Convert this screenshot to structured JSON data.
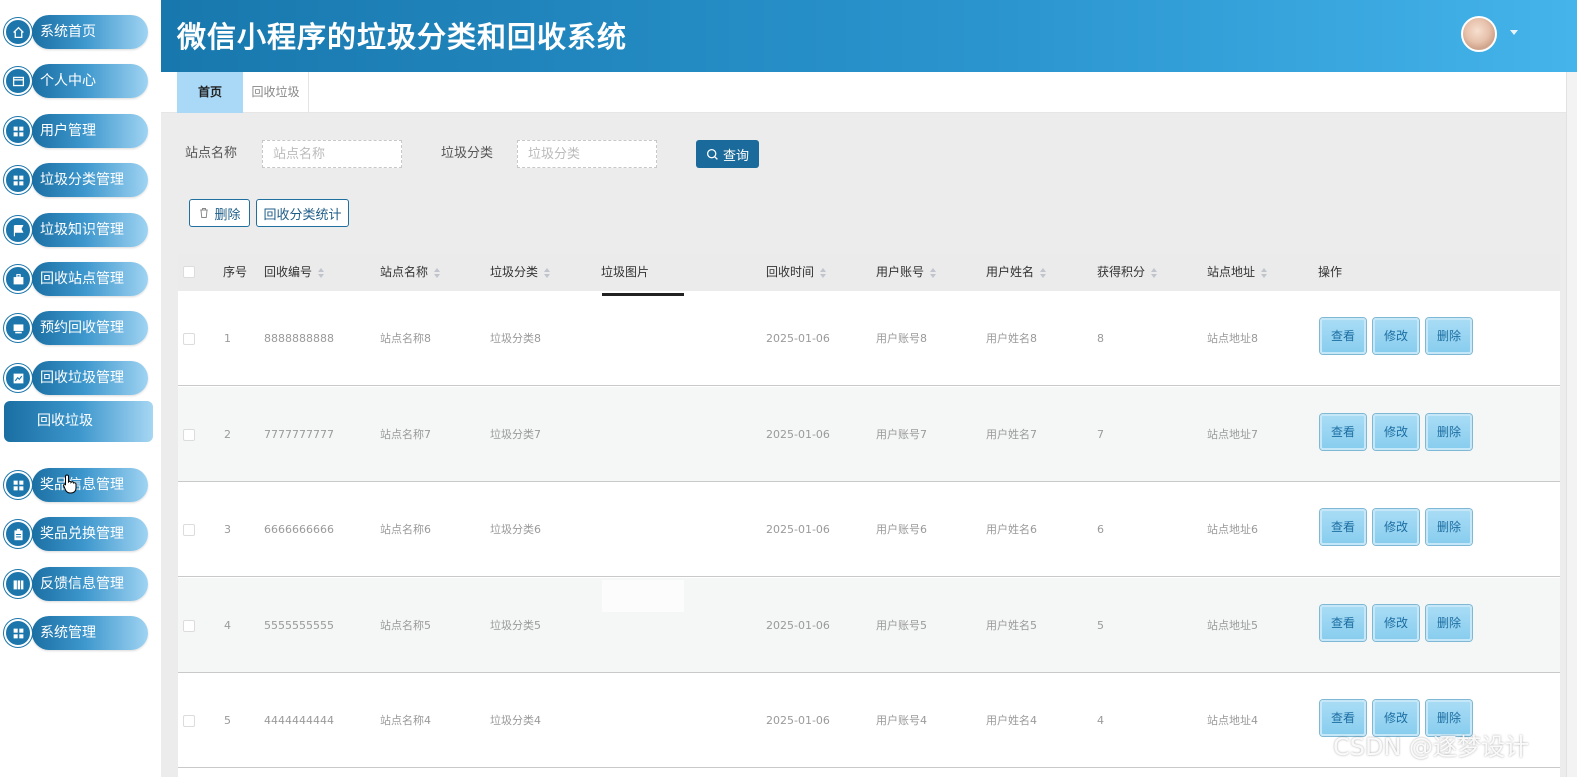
{
  "app": {
    "title": "微信小程序的垃圾分类和回收系统"
  },
  "sidebar": {
    "items": [
      {
        "label": "系统首页",
        "icon": "home-icon"
      },
      {
        "label": "个人中心",
        "icon": "window-icon"
      },
      {
        "label": "用户管理",
        "icon": "grid-icon"
      },
      {
        "label": "垃圾分类管理",
        "icon": "grid-icon"
      },
      {
        "label": "垃圾知识管理",
        "icon": "flag-icon"
      },
      {
        "label": "回收站点管理",
        "icon": "briefcase-icon"
      },
      {
        "label": "预约回收管理",
        "icon": "message-icon"
      },
      {
        "label": "回收垃圾管理",
        "icon": "chart-icon"
      },
      {
        "label": "奖品信息管理",
        "icon": "grid-icon"
      },
      {
        "label": "奖品兑换管理",
        "icon": "clipboard-icon"
      },
      {
        "label": "反馈信息管理",
        "icon": "book-icon"
      },
      {
        "label": "系统管理",
        "icon": "grid-icon"
      }
    ],
    "active_submenu": {
      "label": "回收垃圾"
    }
  },
  "tabs": [
    {
      "label": "首页",
      "active": true
    },
    {
      "label": "回收垃圾",
      "active": false
    }
  ],
  "search": {
    "station_label": "站点名称",
    "station_placeholder": "站点名称",
    "category_label": "垃圾分类",
    "category_placeholder": "垃圾分类",
    "query_button": "查询"
  },
  "toolbar": {
    "delete_label": "删除",
    "stats_label": "回收分类统计"
  },
  "table": {
    "columns": [
      "序号",
      "回收编号",
      "站点名称",
      "垃圾分类",
      "垃圾图片",
      "回收时间",
      "用户账号",
      "用户姓名",
      "获得积分",
      "站点地址",
      "操作"
    ],
    "rows": [
      {
        "index": "1",
        "code": "8888888888",
        "station": "站点名称8",
        "category": "垃圾分类8",
        "time": "2025-01-06",
        "account": "用户账号8",
        "name": "用户姓名8",
        "points": "8",
        "address": "站点地址8"
      },
      {
        "index": "2",
        "code": "7777777777",
        "station": "站点名称7",
        "category": "垃圾分类7",
        "time": "2025-01-06",
        "account": "用户账号7",
        "name": "用户姓名7",
        "points": "7",
        "address": "站点地址7"
      },
      {
        "index": "3",
        "code": "6666666666",
        "station": "站点名称6",
        "category": "垃圾分类6",
        "time": "2025-01-06",
        "account": "用户账号6",
        "name": "用户姓名6",
        "points": "6",
        "address": "站点地址6"
      },
      {
        "index": "4",
        "code": "5555555555",
        "station": "站点名称5",
        "category": "垃圾分类5",
        "time": "2025-01-06",
        "account": "用户账号5",
        "name": "用户姓名5",
        "points": "5",
        "address": "站点地址5"
      },
      {
        "index": "5",
        "code": "4444444444",
        "station": "站点名称4",
        "category": "垃圾分类4",
        "time": "2025-01-06",
        "account": "用户账号4",
        "name": "用户姓名4",
        "points": "4",
        "address": "站点地址4"
      }
    ],
    "actions": {
      "view": "查看",
      "edit": "修改",
      "delete": "删除"
    }
  },
  "watermark": "CSDN @逐梦设计",
  "colors": {
    "header": "#1878ad",
    "accent": "#1a6a9b",
    "action_button": "#89cdee"
  }
}
